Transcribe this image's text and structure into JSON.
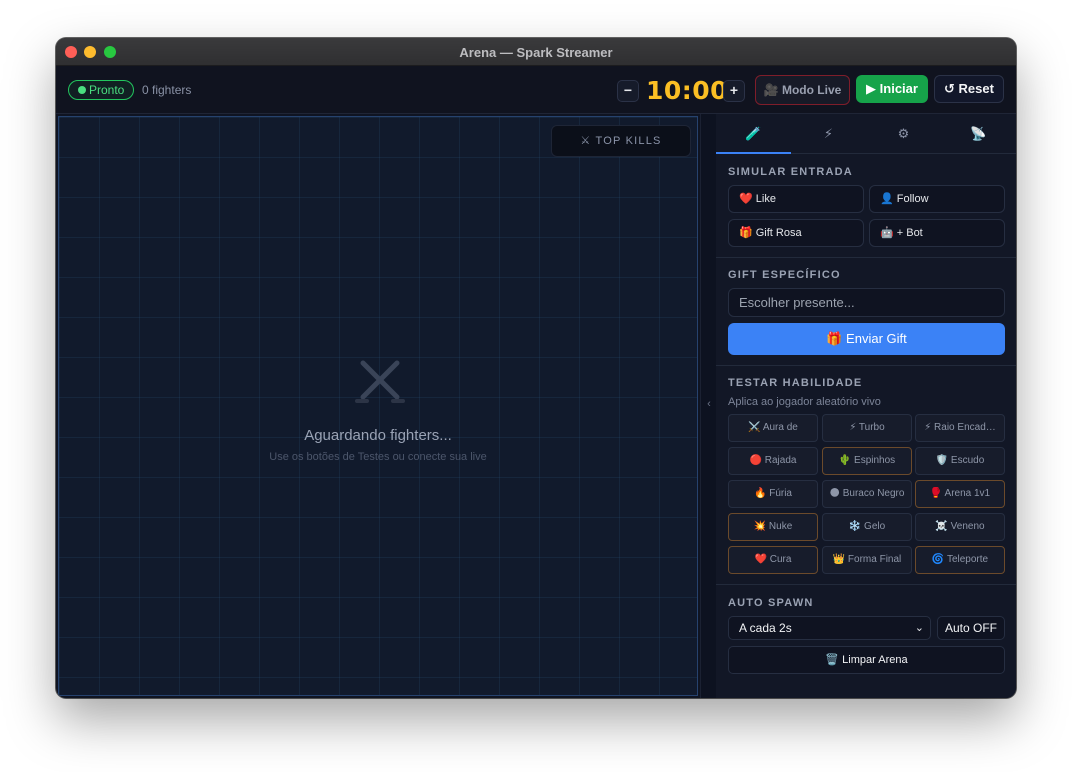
{
  "window": {
    "title": "Arena — Spark Streamer"
  },
  "topbar": {
    "status": "Pronto",
    "fighters": "0 fighters",
    "minus": "−",
    "timer": "10:00",
    "plus": "+",
    "live_btn": "🎥 Modo Live",
    "start_btn": "▶ Iniciar",
    "reset_btn": "↺ Reset"
  },
  "arena": {
    "top_kills": "⚔ TOP KILLS",
    "waiting_title": "Aguardando fighters...",
    "waiting_sub": "Use os botões de Testes ou conecte sua live"
  },
  "panel": {
    "collapse": "‹",
    "tabs": [
      "🧪",
      "⚡",
      "⚙",
      "📡"
    ],
    "simular": {
      "title": "SIMULAR ENTRADA",
      "buttons": [
        "❤️ Like",
        "👤 Follow",
        "🎁 Gift Rosa",
        "🤖 + Bot"
      ]
    },
    "gift": {
      "title": "GIFT ESPECÍFICO",
      "placeholder": "Escolher presente...",
      "send": "🎁 Enviar Gift"
    },
    "skills": {
      "title": "TESTAR HABILIDADE",
      "hint": "Aplica ao jogador aleatório vivo",
      "items": [
        "⚔️ Aura de",
        "⚡ Turbo",
        "⚡ Raio Encad…",
        "🔴 Rajada",
        "🌵 Espinhos",
        "🛡️ Escudo",
        "🔥 Fúria",
        "🌑 Buraco Negro",
        "🥊 Arena 1v1",
        "💥 Nuke",
        "❄️ Gelo",
        "☠️ Veneno",
        "❤️ Cura",
        "👑 Forma Final",
        "🌀 Teleporte"
      ]
    },
    "spawn": {
      "title": "AUTO SPAWN",
      "interval": "A cada 2s",
      "auto": "Auto OFF",
      "clear": "🗑️ Limpar Arena"
    }
  }
}
